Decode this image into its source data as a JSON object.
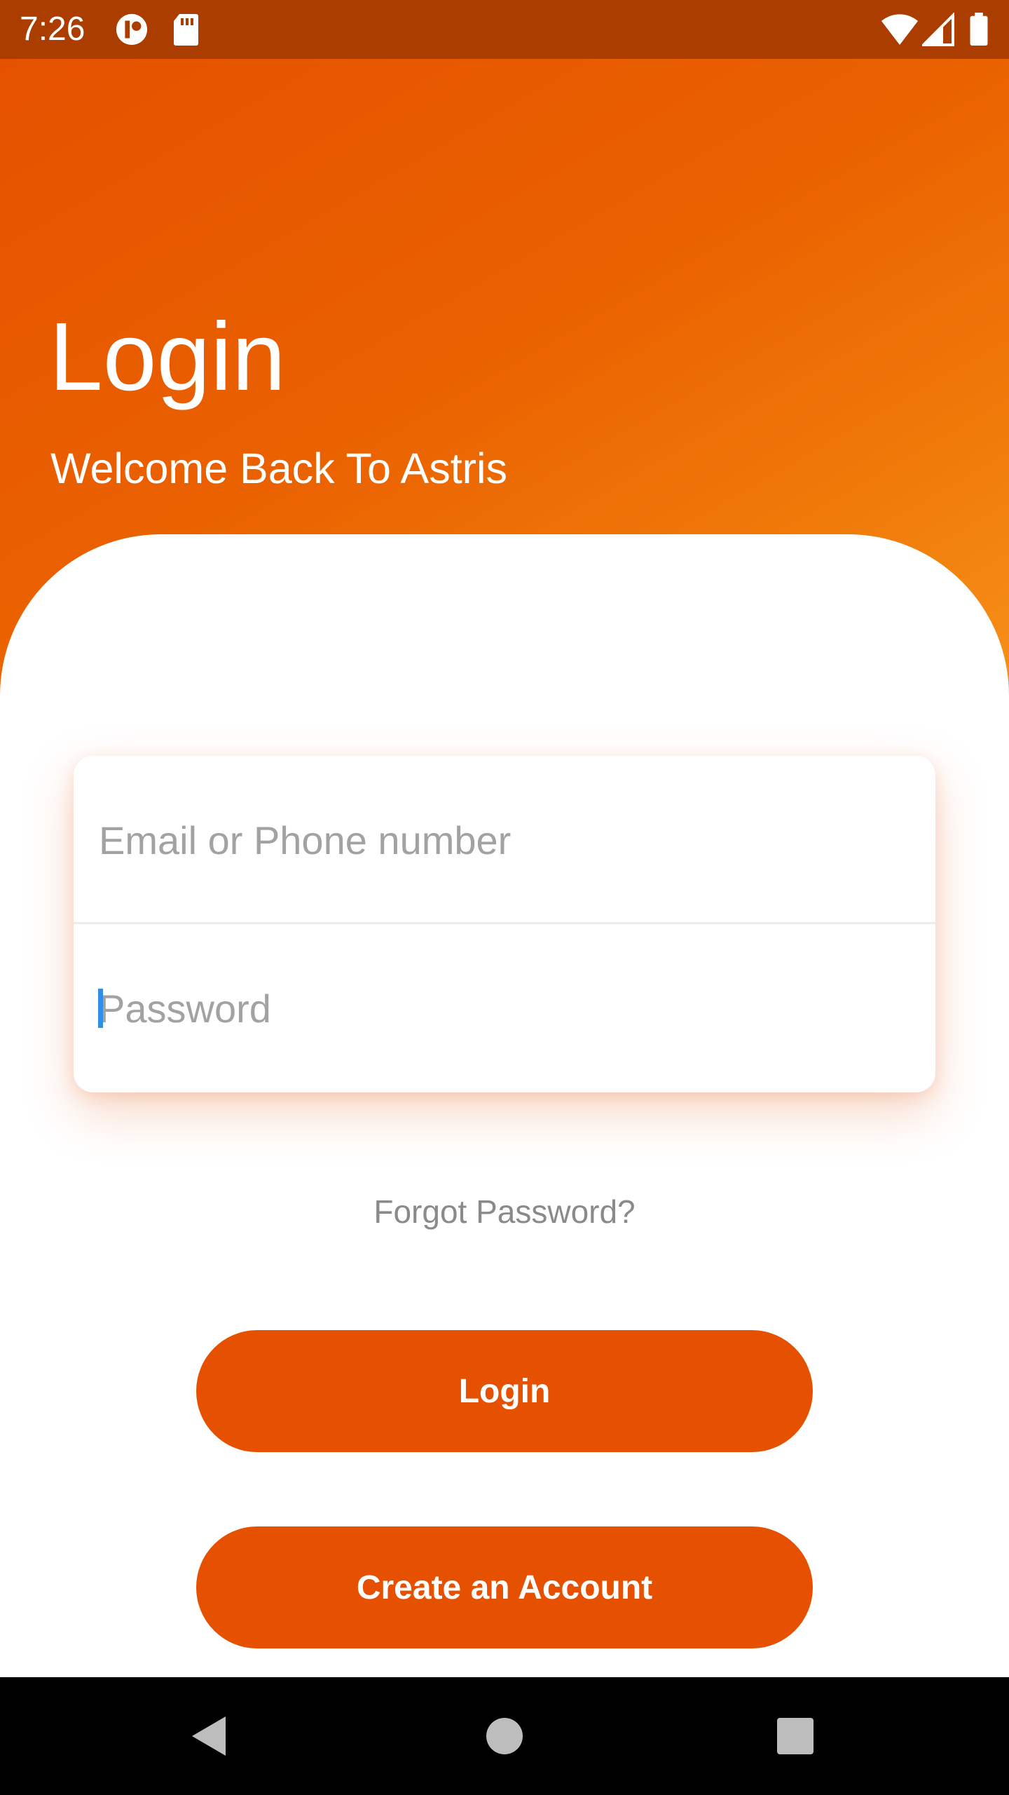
{
  "status_bar": {
    "time": "7:26",
    "left_icons": [
      "notification-app-icon",
      "sd-card-icon"
    ],
    "right_icons": [
      "wifi-icon",
      "cell-signal-icon",
      "battery-icon"
    ]
  },
  "header": {
    "title": "Login",
    "subtitle": "Welcome Back To Astris"
  },
  "form": {
    "email_placeholder": "Email or Phone number",
    "email_value": "",
    "password_placeholder": "Password",
    "password_value": ""
  },
  "links": {
    "forgot_password": "Forgot Password?"
  },
  "buttons": {
    "login": "Login",
    "create_account": "Create an Account"
  },
  "nav_bar": {
    "icons": [
      "back-icon",
      "home-icon",
      "recents-icon"
    ]
  },
  "colors": {
    "accent": "#e55100",
    "status_bar": "#ab3d00",
    "gradient_end": "#f7931a",
    "placeholder": "#a2a2a2",
    "caret": "#2f8fe6"
  }
}
